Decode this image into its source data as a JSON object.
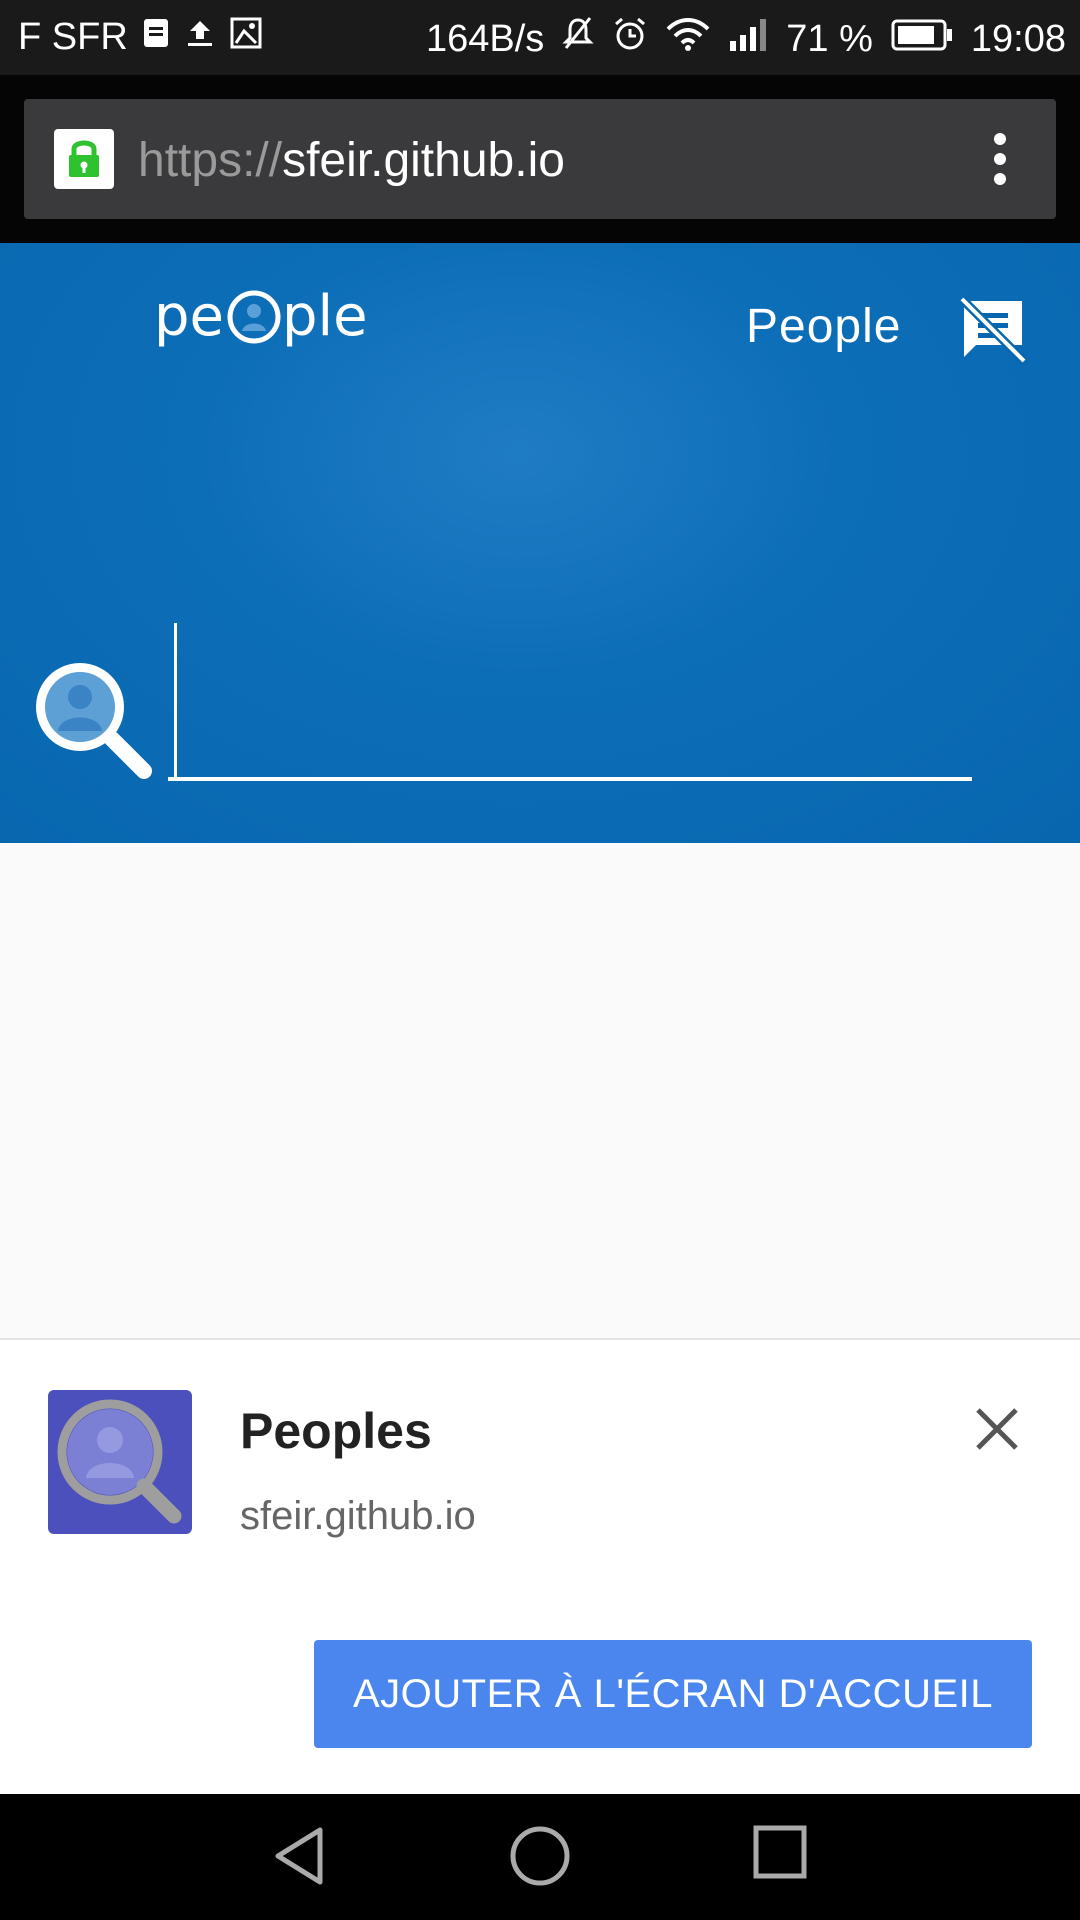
{
  "status_bar": {
    "carrier": "F SFR",
    "speed": "164B/s",
    "battery": "71 %",
    "time": "19:08"
  },
  "browser": {
    "url_scheme": "https://",
    "url_host": "sfeir.github.io"
  },
  "header": {
    "title": "People",
    "logo_text": "people"
  },
  "search": {
    "value": "",
    "placeholder": ""
  },
  "install_banner": {
    "app_name": "Peoples",
    "app_url": "sfeir.github.io",
    "button_label": "AJOUTER À L'ÉCRAN D'ACCUEIL"
  },
  "colors": {
    "hero": "#0766ae",
    "button": "#4a86ee",
    "app_icon": "#4b50bd"
  }
}
